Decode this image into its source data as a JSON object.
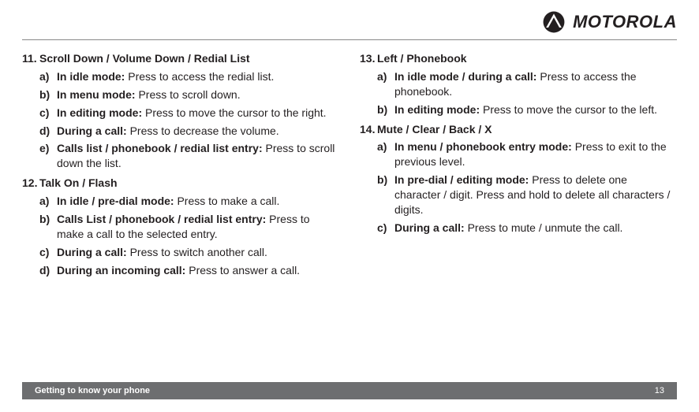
{
  "brand": "MOTOROLA",
  "col1": {
    "s11": {
      "num": "11.",
      "title": "Scroll Down / Volume Down / Redial List",
      "a_label": "a)",
      "a_head": "In idle mode: ",
      "a_text": "Press to access the redial list.",
      "b_label": "b)",
      "b_head": "In menu mode: ",
      "b_text": "Press to scroll down.",
      "c_label": "c)",
      "c_head": "In editing mode: ",
      "c_text": "Press to move the cursor to the right.",
      "d_label": "d)",
      "d_head": "During a call: ",
      "d_text": "Press to decrease the volume.",
      "e_label": "e)",
      "e_head": "Calls list / phonebook / redial list entry: ",
      "e_text": "Press to scroll down the list."
    },
    "s12": {
      "num": "12.",
      "title": "Talk On / Flash",
      "a_label": "a)",
      "a_head": "In idle / pre-dial mode: ",
      "a_text": "Press to make a call.",
      "b_label": "b)",
      "b_head": "Calls List / phonebook / redial list entry: ",
      "b_text": "Press to make a call to the selected entry.",
      "c_label": "c)",
      "c_head": "During a call: ",
      "c_text": "Press to switch another call.",
      "d_label": "d)",
      "d_head": "During an incoming call: ",
      "d_text": "Press to answer a call."
    }
  },
  "col2": {
    "s13": {
      "num": "13.",
      "title": "Left / Phonebook",
      "a_label": "a)",
      "a_head": "In idle mode / during a call: ",
      "a_text": "Press to access the phonebook.",
      "b_label": "b)",
      "b_head": "In editing mode: ",
      "b_text": "Press to move the cursor to the left."
    },
    "s14": {
      "num": "14.",
      "title": "Mute / Clear / Back / X",
      "a_label": "a)",
      "a_head": "In menu / phonebook entry mode: ",
      "a_text": "Press to exit to the previous level.",
      "b_label": "b)",
      "b_head": "In pre-dial / editing mode: ",
      "b_text": "Press to delete one character / digit. Press and hold to delete all characters / digits.",
      "c_label": "c)",
      "c_head": "During a call: ",
      "c_text": "Press to mute / unmute the call."
    }
  },
  "footer": {
    "title": "Getting to know your phone",
    "page": "13"
  }
}
